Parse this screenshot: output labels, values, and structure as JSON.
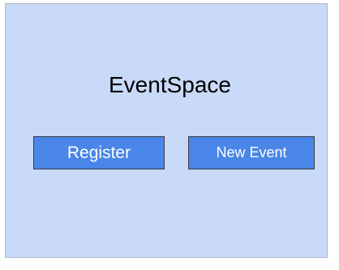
{
  "app": {
    "title": "EventSpace"
  },
  "actions": {
    "register_label": "Register",
    "new_event_label": "New Event"
  },
  "colors": {
    "background": "#c9daf8",
    "button": "#4a86e8",
    "button_text": "#ffffff"
  }
}
